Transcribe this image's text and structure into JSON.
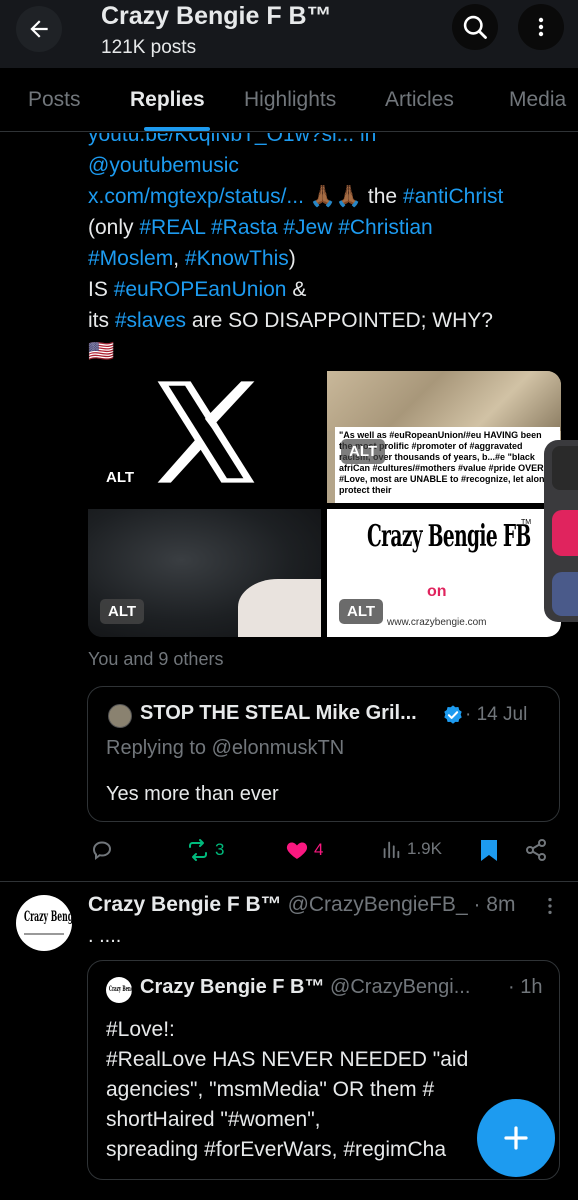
{
  "header": {
    "title": "Crazy Bengie F B™",
    "post_count": "121K posts"
  },
  "tabs": [
    {
      "label": "Posts",
      "active": false
    },
    {
      "label": "Replies",
      "active": true
    },
    {
      "label": "Highlights",
      "active": false
    },
    {
      "label": "Articles",
      "active": false
    },
    {
      "label": "Media",
      "active": false
    }
  ],
  "tweet": {
    "lines": {
      "l0": "youtu.be/KcqiNbT_O1w?si... in",
      "l1": "@youtubemusic",
      "l2a": "x.com/mgtexp/status/...",
      "l2b": "🙏🏾🙏🏾",
      "l2c": "the",
      "l2d": "#antiChrist",
      "l3a": "(only",
      "l3b": "#REAL #Rasta #Jew #Christian",
      "l4a": "#Moslem",
      "l4b": ",",
      "l4c": "#KnowThis",
      "l4d": ")",
      "l5a": "IS",
      "l5b": "#euROPEanUnion",
      "l5c": "&",
      "l6a": "its",
      "l6b": "#slaves",
      "l6c": "are SO DISAPPOINTED; WHY?",
      "l7": "🇺🇸"
    },
    "media": {
      "alt_label": "ALT",
      "img2_text": "\"As well as #euRopeanUnion/#eu HAVING been the most prolific #promoter of #aggravated racism, over thousands of years, b...#e \"black afriCan #cultures/#mothers #value #pride OVER #Love, most are UNABLE to #recognize, let alonE protect their",
      "img4_logo": "Crazy Bengie FB",
      "img4_on": "on",
      "img4_tm": "TM",
      "img4_url": "www.crazybengie.com"
    },
    "social_context": "You and 9 others",
    "quote": {
      "author": "STOP THE STEAL Mike Gril...",
      "time": "· 14 Jul",
      "replying_to": "Replying to @elonmuskTN",
      "text": "Yes more than ever"
    },
    "actions": {
      "reposts": "3",
      "likes": "4",
      "views": "1.9K"
    }
  },
  "tweet2": {
    "author": "Crazy Bengie F B™",
    "handle": "@CrazyBengieFB_",
    "time": "· 8m",
    "text": ". ....",
    "avatar_logo": "Crazy Bengie FB",
    "quote": {
      "author": "Crazy Bengie F B™",
      "handle": "@CrazyBengi...",
      "time": "· 1h",
      "lines": {
        "l0": "#Love!:",
        "l1": "#RealLove HAS NEVER NEEDED \"aid",
        "l2": "agencies\", \"msmMedia\" OR them #",
        "l3": "shortHaired \"#women\",",
        "l4": "spreading #forEverWars, #regimCha"
      }
    }
  },
  "colors": {
    "accent": "#1d9bf0",
    "like": "#f91880",
    "repost": "#00ba7c",
    "background": "#000000"
  },
  "icons": [
    "back-arrow-icon",
    "search-icon",
    "more-vertical-icon",
    "reply-icon",
    "repost-icon",
    "heart-icon",
    "views-icon",
    "bookmark-icon",
    "share-icon",
    "verified-icon",
    "plus-icon"
  ]
}
